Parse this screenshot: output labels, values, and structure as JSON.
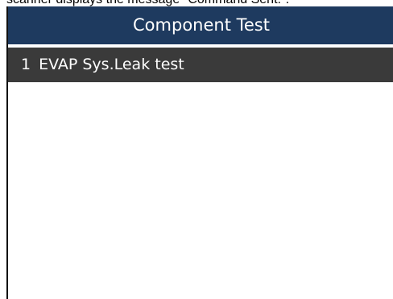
{
  "caption": "scanner displays the message \"Command Sent.\".",
  "header": {
    "title": "Component Test"
  },
  "list": {
    "items": [
      {
        "number": "1",
        "label": "EVAP Sys.Leak test"
      }
    ]
  },
  "colors": {
    "title_bar": "#1e3a5f",
    "selected_item": "#3a3a3a",
    "text_light": "#ffffff"
  }
}
